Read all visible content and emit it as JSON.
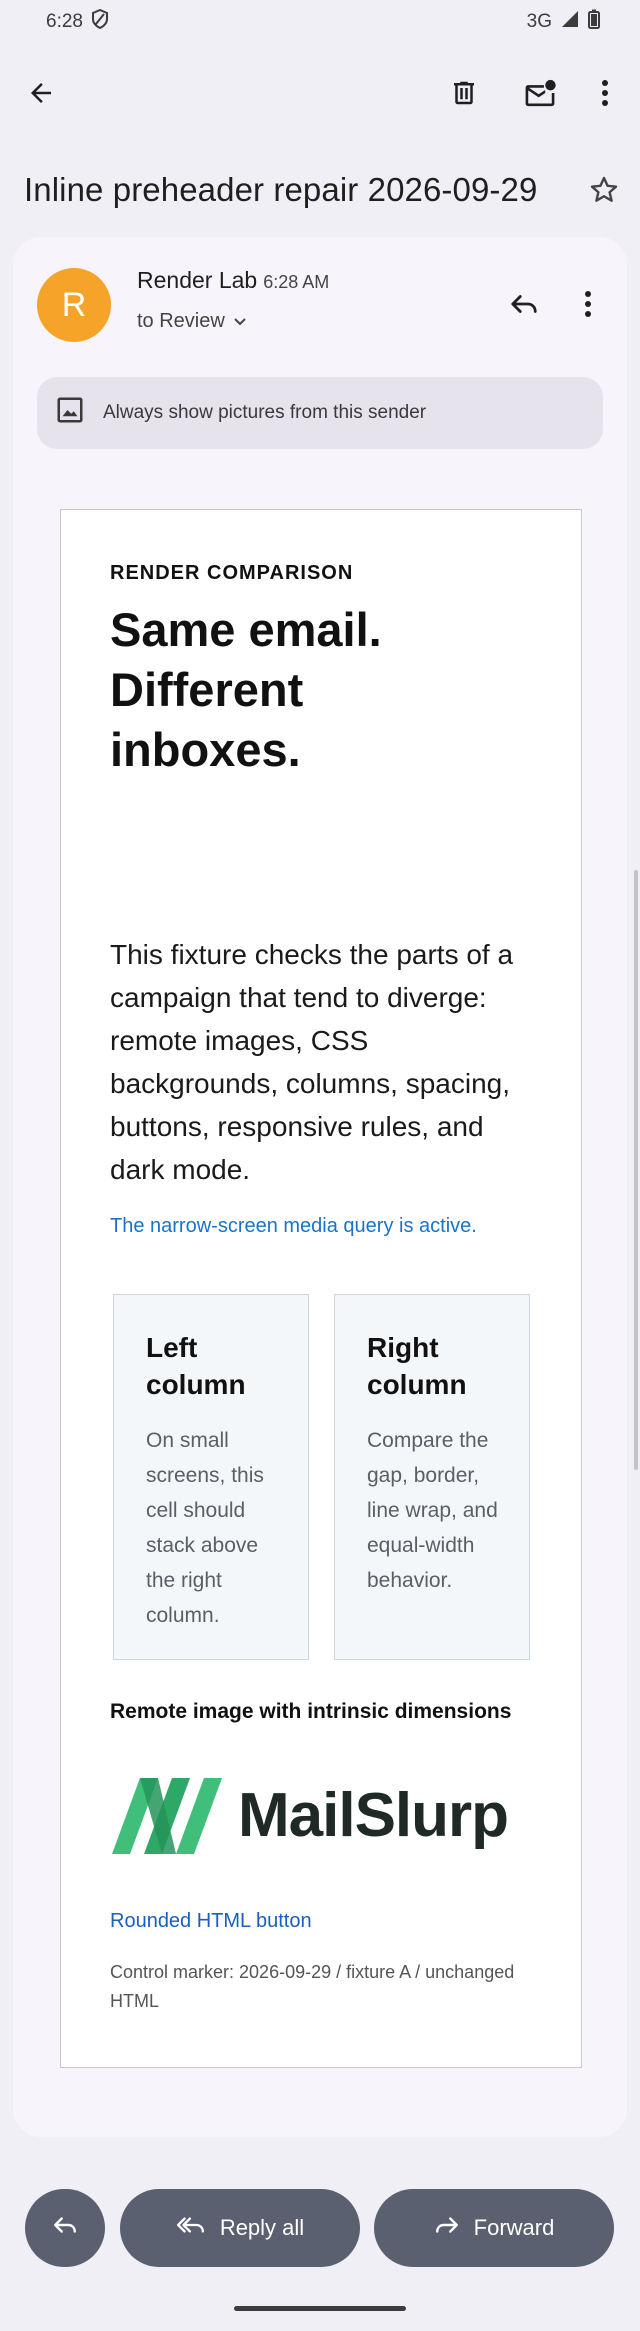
{
  "status_bar": {
    "time": "6:28",
    "network": "3G"
  },
  "toolbar": {
    "back_icon": "arrow-left-icon",
    "delete_icon": "trash-icon",
    "mark_unread_icon": "mail-unread-icon",
    "more_icon": "more-vert-icon"
  },
  "subject": "Inline preheader repair 2026-09-29",
  "message": {
    "avatar_letter": "R",
    "avatar_color": "#f6a32a",
    "sender": "Render Lab",
    "time": "6:28 AM",
    "to": "to Review",
    "pictures_banner": "Always show pictures from this sender"
  },
  "email": {
    "eyebrow": "RENDER COMPARISON",
    "headline": "Same email. Different inboxes.",
    "body": "This fixture checks the parts of a campaign that tend to diverge: remote images, CSS backgrounds, columns, spacing, buttons, responsive rules, and dark mode.",
    "media_note": "The narrow-screen media query is active.",
    "left_column": {
      "title": "Left column",
      "text": "On small screens, this cell should stack above the right column."
    },
    "right_column": {
      "title": "Right column",
      "text": "Compare the gap, border, line wrap, and equal-width behavior."
    },
    "image_caption": "Remote image with intrinsic dimensions",
    "logo_text": "MailSlurp",
    "button_link": "Rounded HTML button",
    "control_marker": "Control marker: 2026-09-29 / fixture A / unchanged HTML"
  },
  "actions": {
    "reply_label": "",
    "reply_all_label": "Reply all",
    "forward_label": "Forward"
  },
  "colors": {
    "accent_link": "#1a73c8",
    "action_pill": "#5a6070",
    "logo_green": "#3fbf7a"
  }
}
